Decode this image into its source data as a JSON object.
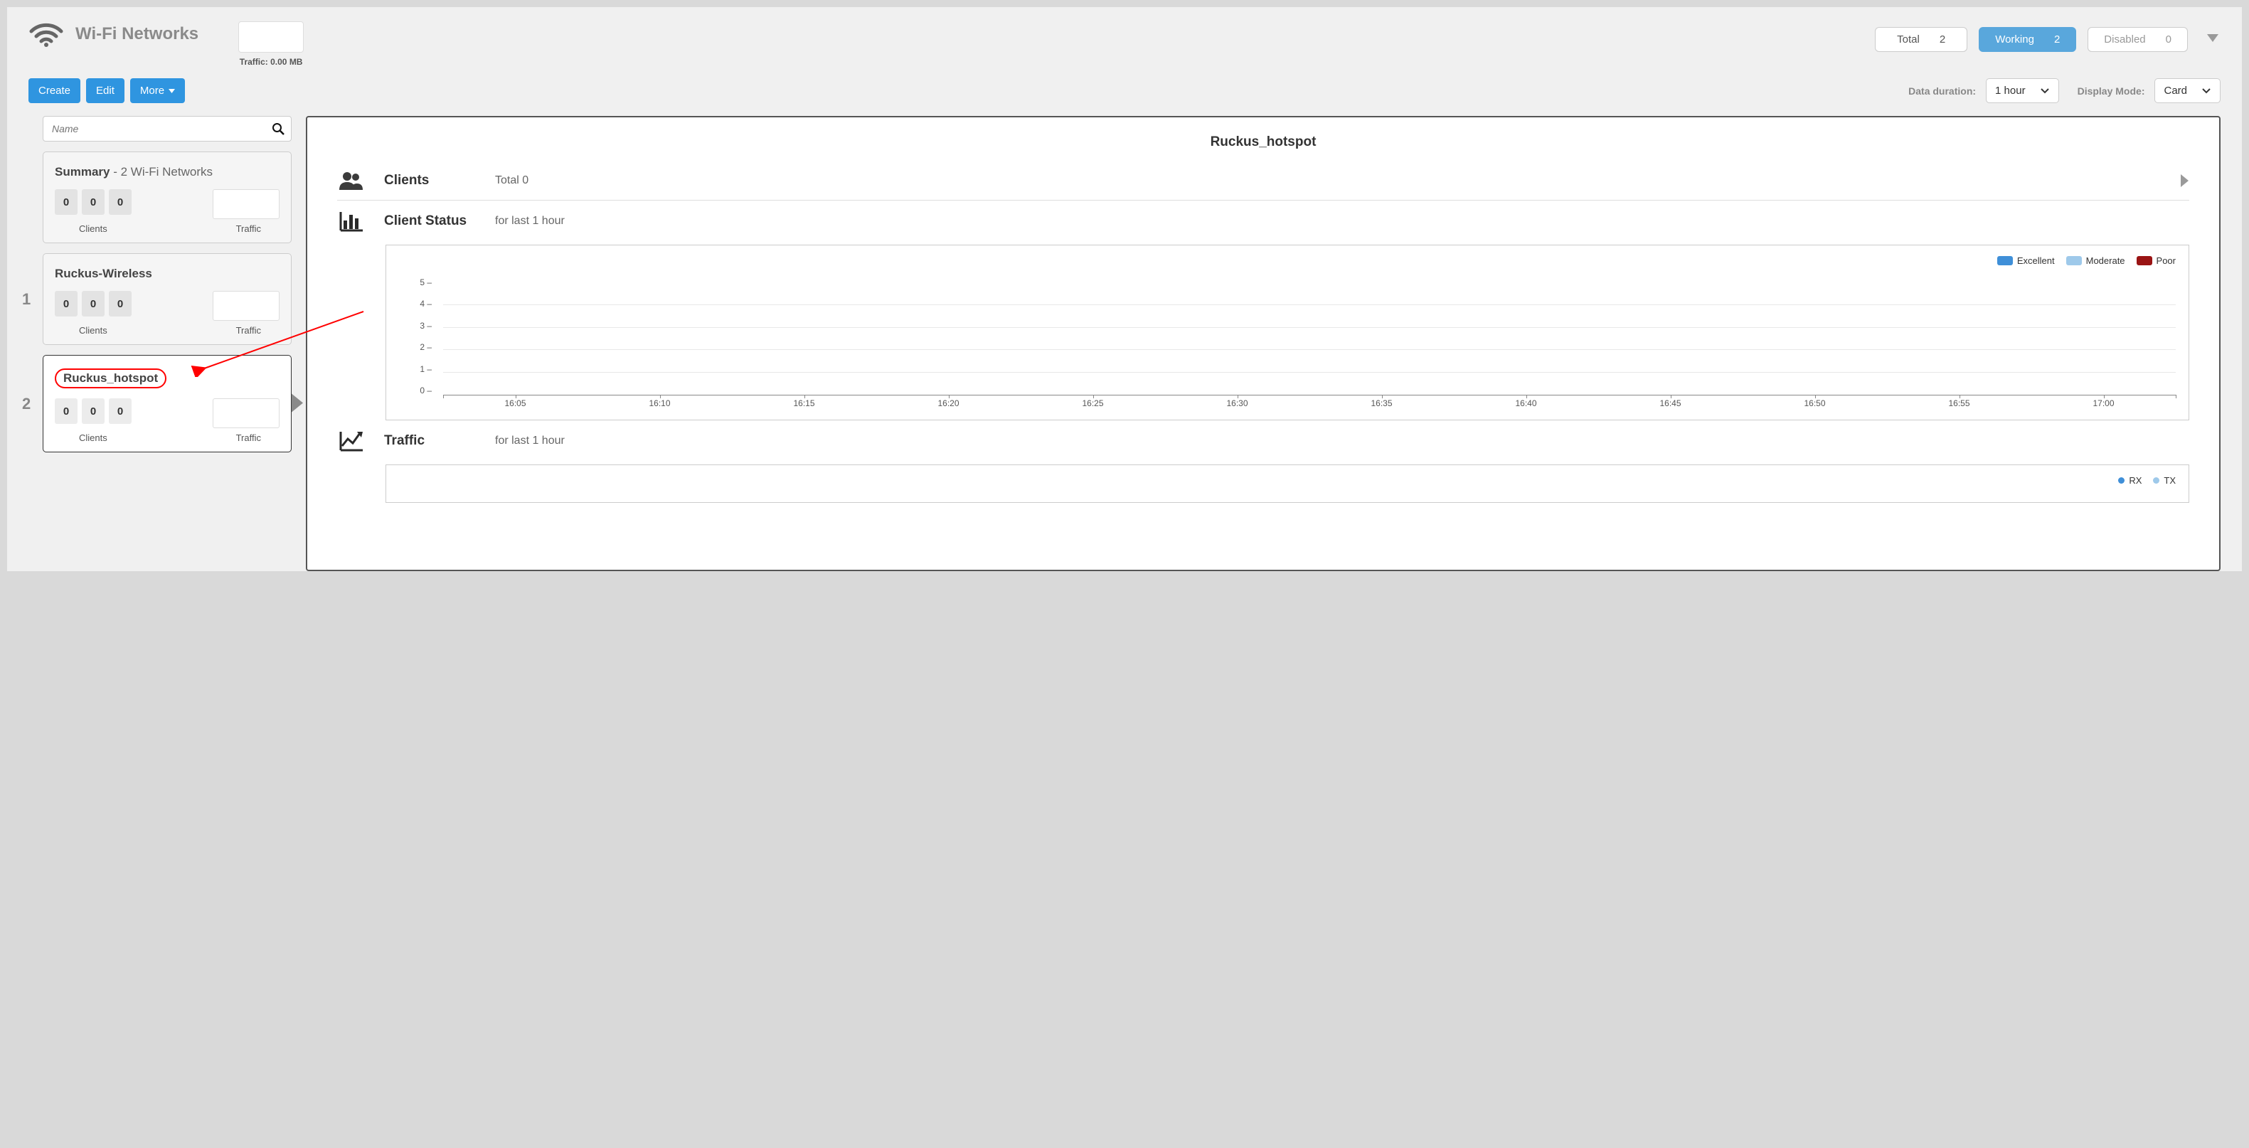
{
  "header": {
    "title": "Wi-Fi Networks",
    "traffic_caption": "Traffic: 0.00 MB",
    "status": {
      "total": {
        "label": "Total",
        "count": 2
      },
      "working": {
        "label": "Working",
        "count": 2
      },
      "disabled": {
        "label": "Disabled",
        "count": 0
      }
    }
  },
  "toolbar": {
    "create": "Create",
    "edit": "Edit",
    "more": "More",
    "duration_label": "Data duration:",
    "duration_value": "1 hour",
    "mode_label": "Display Mode:",
    "mode_value": "Card"
  },
  "sidebar": {
    "search_placeholder": "Name",
    "summary": {
      "title": "Summary",
      "subtitle": "2 Wi-Fi Networks",
      "counts": [
        0,
        0,
        0
      ],
      "clients_label": "Clients",
      "traffic_label": "Traffic"
    },
    "items": [
      {
        "index": "1",
        "name": "Ruckus-Wireless",
        "counts": [
          0,
          0,
          0
        ],
        "clients_label": "Clients",
        "traffic_label": "Traffic",
        "selected": false
      },
      {
        "index": "2",
        "name": "Ruckus_hotspot",
        "counts": [
          0,
          0,
          0
        ],
        "clients_label": "Clients",
        "traffic_label": "Traffic",
        "selected": true
      }
    ]
  },
  "panel": {
    "title": "Ruckus_hotspot",
    "clients": {
      "title": "Clients",
      "total": "Total 0"
    },
    "client_status": {
      "title": "Client Status",
      "subtitle": "for last 1 hour",
      "legend": [
        {
          "label": "Excellent",
          "color": "#3f8fd8"
        },
        {
          "label": "Moderate",
          "color": "#9ec9ea"
        },
        {
          "label": "Poor",
          "color": "#9a1414"
        }
      ]
    },
    "traffic": {
      "title": "Traffic",
      "subtitle": "for last 1 hour",
      "legend": [
        {
          "label": "RX",
          "color": "#3f8fd8"
        },
        {
          "label": "TX",
          "color": "#9ec9ea"
        }
      ]
    }
  },
  "chart_data": {
    "type": "bar",
    "title": "Client Status",
    "xlabel": "",
    "ylabel": "",
    "ylim": [
      0,
      5
    ],
    "y_ticks": [
      0,
      1,
      2,
      3,
      4,
      5
    ],
    "categories": [
      "16:05",
      "16:10",
      "16:15",
      "16:20",
      "16:25",
      "16:30",
      "16:35",
      "16:40",
      "16:45",
      "16:50",
      "16:55",
      "17:00"
    ],
    "series": [
      {
        "name": "Excellent",
        "values": [
          0,
          0,
          0,
          0,
          0,
          0,
          0,
          0,
          0,
          0,
          0,
          0
        ]
      },
      {
        "name": "Moderate",
        "values": [
          0,
          0,
          0,
          0,
          0,
          0,
          0,
          0,
          0,
          0,
          0,
          0
        ]
      },
      {
        "name": "Poor",
        "values": [
          0,
          0,
          0,
          0,
          0,
          0,
          0,
          0,
          0,
          0,
          0,
          0
        ]
      }
    ]
  }
}
